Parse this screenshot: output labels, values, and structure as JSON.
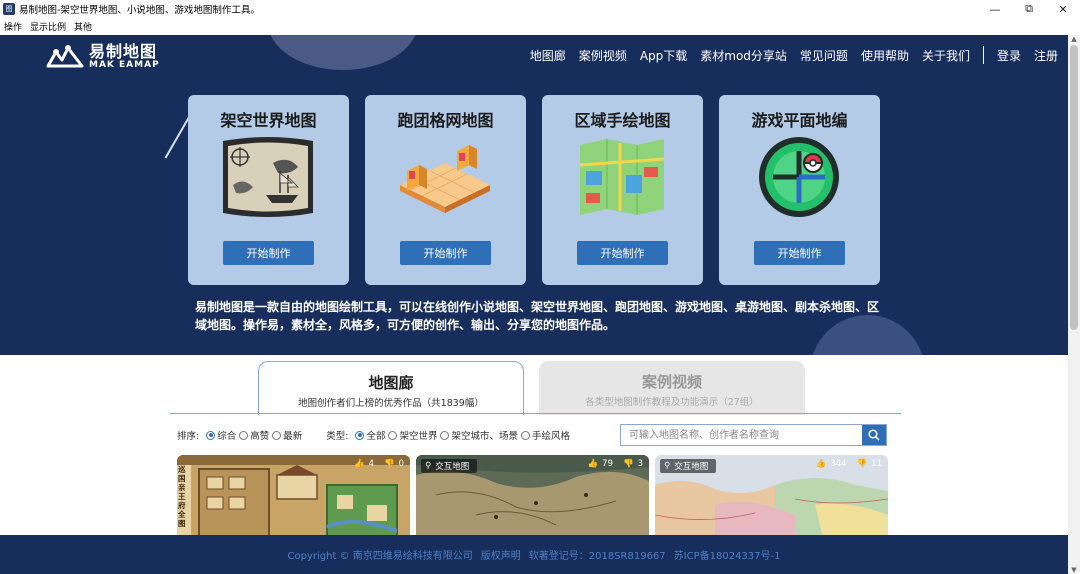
{
  "window": {
    "title": "易制地图-架空世界地图、小说地图、游戏地图制作工具。"
  },
  "menu": [
    "操作",
    "显示比例",
    "其他"
  ],
  "logo": {
    "cn": "易制地图",
    "en": "MAK EAMAP"
  },
  "nav": {
    "items": [
      "地图廊",
      "案例视频",
      "App下载",
      "素材mod分享站",
      "常见问题",
      "使用帮助",
      "关于我们"
    ],
    "login": "登录",
    "register": "注册"
  },
  "cards": [
    {
      "title": "架空世界地图",
      "button": "开始制作",
      "icon": "treasure-map-icon"
    },
    {
      "title": "跑团格网地图",
      "button": "开始制作",
      "icon": "isometric-grid-icon"
    },
    {
      "title": "区域手绘地图",
      "button": "开始制作",
      "icon": "folded-map-icon"
    },
    {
      "title": "游戏平面地编",
      "button": "开始制作",
      "icon": "game-ball-icon"
    }
  ],
  "hero_desc": "易制地图是一款自由的地图绘制工具，可以在线创作小说地图、架空世界地图、跑团地图、游戏地图、桌游地图、剧本杀地图、区域地图。操作易，素材全，风格多，可方便的创作、输出、分享您的地图作品。",
  "tabs": [
    {
      "title": "地图廊",
      "sub": "地图创作者们上榜的优秀作品（共1839幅）"
    },
    {
      "title": "案例视频",
      "sub": "各类型地图制作教程及功能演示（27组）"
    }
  ],
  "filters": {
    "sort_label": "排序:",
    "sort_options": [
      "综合",
      "高赞",
      "最新"
    ],
    "sort_selected": 0,
    "type_label": "类型:",
    "type_options": [
      "全部",
      "架空世界",
      "架空城市、场景",
      "手绘风格"
    ],
    "type_selected": 0
  },
  "search": {
    "placeholder": "可输入地图名称、创作者名称查询"
  },
  "gallery": [
    {
      "badge": "",
      "likes": "4",
      "dislikes": "0",
      "side_text": "巡国亲王府全图"
    },
    {
      "badge": "交互地图",
      "likes": "79",
      "dislikes": "3"
    },
    {
      "badge": "交互地图",
      "likes": "344",
      "dislikes": "11"
    }
  ],
  "footer": [
    "Copyright © 南京四维易绘科技有限公司",
    "版权声明",
    "软著登记号：2018SR819667",
    "苏ICP备18024337号-1"
  ],
  "colors": {
    "hero_bg": "#172d5c",
    "card_bg": "#b3cbe7",
    "button_bg": "#2f6fb7",
    "footer_text": "#4f82c6"
  }
}
